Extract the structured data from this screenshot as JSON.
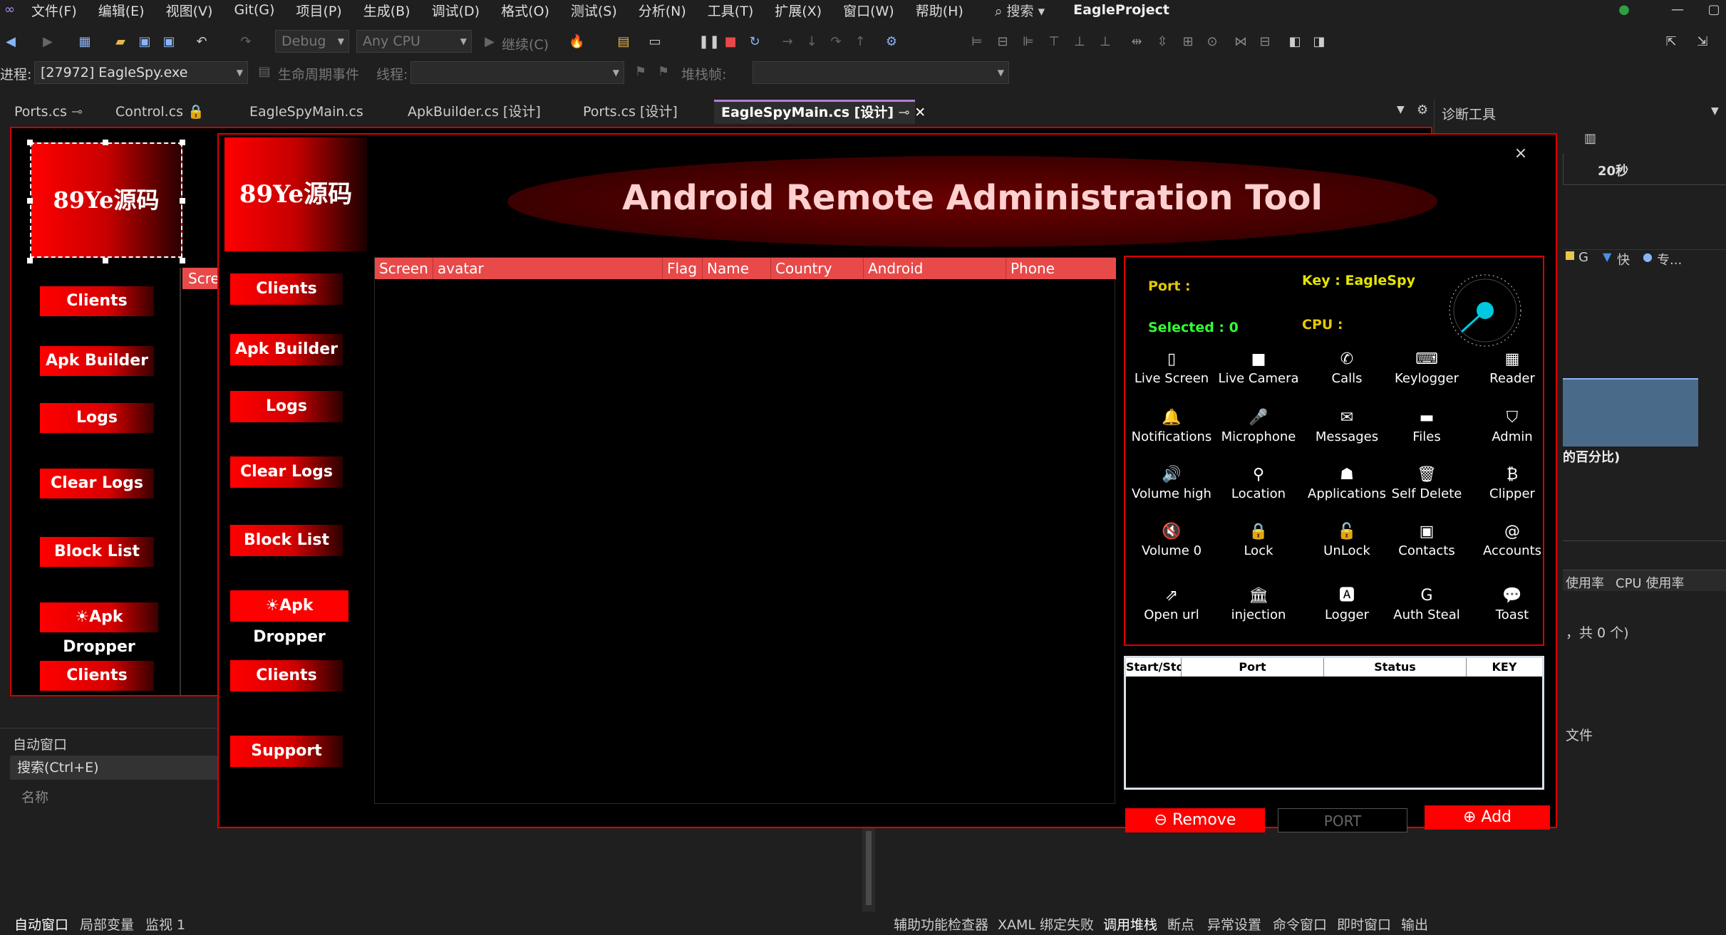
{
  "menu": {
    "items": [
      "文件(F)",
      "编辑(E)",
      "视图(V)",
      "Git(G)",
      "项目(P)",
      "生成(B)",
      "调试(D)",
      "格式(O)",
      "测试(S)",
      "分析(N)",
      "工具(T)",
      "扩展(X)",
      "窗口(W)",
      "帮助(H)"
    ],
    "search": "搜索",
    "project": "EagleProject"
  },
  "toolbar": {
    "config": "Debug",
    "platform": "Any CPU",
    "continue": "继续(C)",
    "process_label": "进程:",
    "process_value": "[27972] EagleSpy.exe",
    "lifecycle": "生命周期事件",
    "thread_label": "线程:",
    "stackframe_label": "堆栈帧:"
  },
  "tabs": [
    {
      "label": "Ports.cs"
    },
    {
      "label": "Control.cs"
    },
    {
      "label": "EagleSpyMain.cs"
    },
    {
      "label": "ApkBuilder.cs [设计]"
    },
    {
      "label": "Ports.cs [设计]"
    },
    {
      "label": "EagleSpyMain.cs [设计]"
    }
  ],
  "diag": {
    "title": "诊断工具",
    "time": "20秒",
    "legend_g": "G",
    "legend_fast": "快",
    "legend_special": "专...",
    "percent": "的百分比)",
    "usage1": "使用率",
    "usage2": "CPU 使用率",
    "count": "，共 0 个)",
    "file": "文件"
  },
  "designer": {
    "logo": "89Ye源码",
    "partial": "Scre",
    "buttons": [
      "Clients",
      "Apk Builder",
      "Logs",
      "Clear Logs",
      "Block List",
      "Apk Dropper",
      "Clients"
    ]
  },
  "autos": {
    "title": "自动窗口",
    "search": "搜索(Ctrl+E)",
    "col_name": "名称"
  },
  "bottom": {
    "left": [
      "自动窗口",
      "局部变量",
      "监视 1"
    ],
    "right": [
      "辅助功能检查器",
      "XAML 绑定失败",
      "调用堆栈",
      "断点",
      "异常设置",
      "命令窗口",
      "即时窗口",
      "输出"
    ]
  },
  "app": {
    "logo": "89Ye源码",
    "title": "Android Remote Administration Tool",
    "close": "×",
    "nav": [
      "Clients",
      "Apk Builder",
      "Logs",
      "Clear Logs",
      "Block List",
      "Apk Dropper",
      "Clients",
      "Support"
    ],
    "grid_columns": [
      "Screen",
      "avatar",
      "Flag",
      "Name",
      "Country",
      "Android",
      "Phone"
    ],
    "port_label": "Port :",
    "key_label": "Key : EagleSpy",
    "selected_label": "Selected : 0",
    "cpu_label": "CPU :",
    "commands": [
      {
        "label": "Live Screen",
        "icon": "tablet-icon",
        "glyph": "▯"
      },
      {
        "label": "Live Camera",
        "icon": "video-camera-icon",
        "glyph": "■"
      },
      {
        "label": "Calls",
        "icon": "phone-icon",
        "glyph": "✆"
      },
      {
        "label": "Keylogger",
        "icon": "keyboard-icon",
        "glyph": "⌨"
      },
      {
        "label": "Reader",
        "icon": "building-icon",
        "glyph": "▦"
      },
      {
        "label": "Notifications",
        "icon": "bell-icon",
        "glyph": "🔔"
      },
      {
        "label": "Microphone",
        "icon": "microphone-icon",
        "glyph": "🎤"
      },
      {
        "label": "Messages",
        "icon": "envelope-icon",
        "glyph": "✉"
      },
      {
        "label": "Files",
        "icon": "folder-icon",
        "glyph": "▬"
      },
      {
        "label": "Admin",
        "icon": "shield-icon",
        "glyph": "⛉"
      },
      {
        "label": "Volume high",
        "icon": "volume-high-icon",
        "glyph": "🔊"
      },
      {
        "label": "Location",
        "icon": "map-marker-icon",
        "glyph": "⚲"
      },
      {
        "label": "Applications",
        "icon": "android-icon",
        "glyph": "☗"
      },
      {
        "label": "Self Delete",
        "icon": "trash-icon",
        "glyph": "🗑"
      },
      {
        "label": "Clipper",
        "icon": "bitcoin-icon",
        "glyph": "₿"
      },
      {
        "label": "Volume 0",
        "icon": "volume-off-icon",
        "glyph": "🔇"
      },
      {
        "label": "Lock",
        "icon": "lock-icon",
        "glyph": "🔒"
      },
      {
        "label": "UnLock",
        "icon": "unlock-icon",
        "glyph": "🔓"
      },
      {
        "label": "Contacts",
        "icon": "address-book-icon",
        "glyph": "▣"
      },
      {
        "label": "Accounts",
        "icon": "at-icon",
        "glyph": "@"
      },
      {
        "label": "Open url",
        "icon": "external-link-icon",
        "glyph": "⇗"
      },
      {
        "label": "injection",
        "icon": "bank-icon",
        "glyph": "🏛"
      },
      {
        "label": "Logger",
        "icon": "font-a-icon",
        "glyph": "🅰"
      },
      {
        "label": "Auth Steal",
        "icon": "google-icon",
        "glyph": "G"
      },
      {
        "label": "Toast",
        "icon": "comments-icon",
        "glyph": "💬"
      }
    ],
    "port_table": {
      "columns": [
        "Start/Stop",
        "Port",
        "Status",
        "KEY"
      ]
    },
    "remove": "Remove",
    "port_input": "PORT",
    "add": "Add",
    "gauge_ticks": [
      "0",
      "10",
      "20",
      "30",
      "40",
      "50",
      "60",
      "70",
      "80",
      "90",
      "100"
    ]
  },
  "colors": {
    "accent": "#e00000",
    "grid_header": "#e84a4a",
    "cyan": "#00c8e0",
    "key_yellow": "#e6e600",
    "port_yellow": "#e6c800",
    "selected_green": "#33ff33"
  }
}
